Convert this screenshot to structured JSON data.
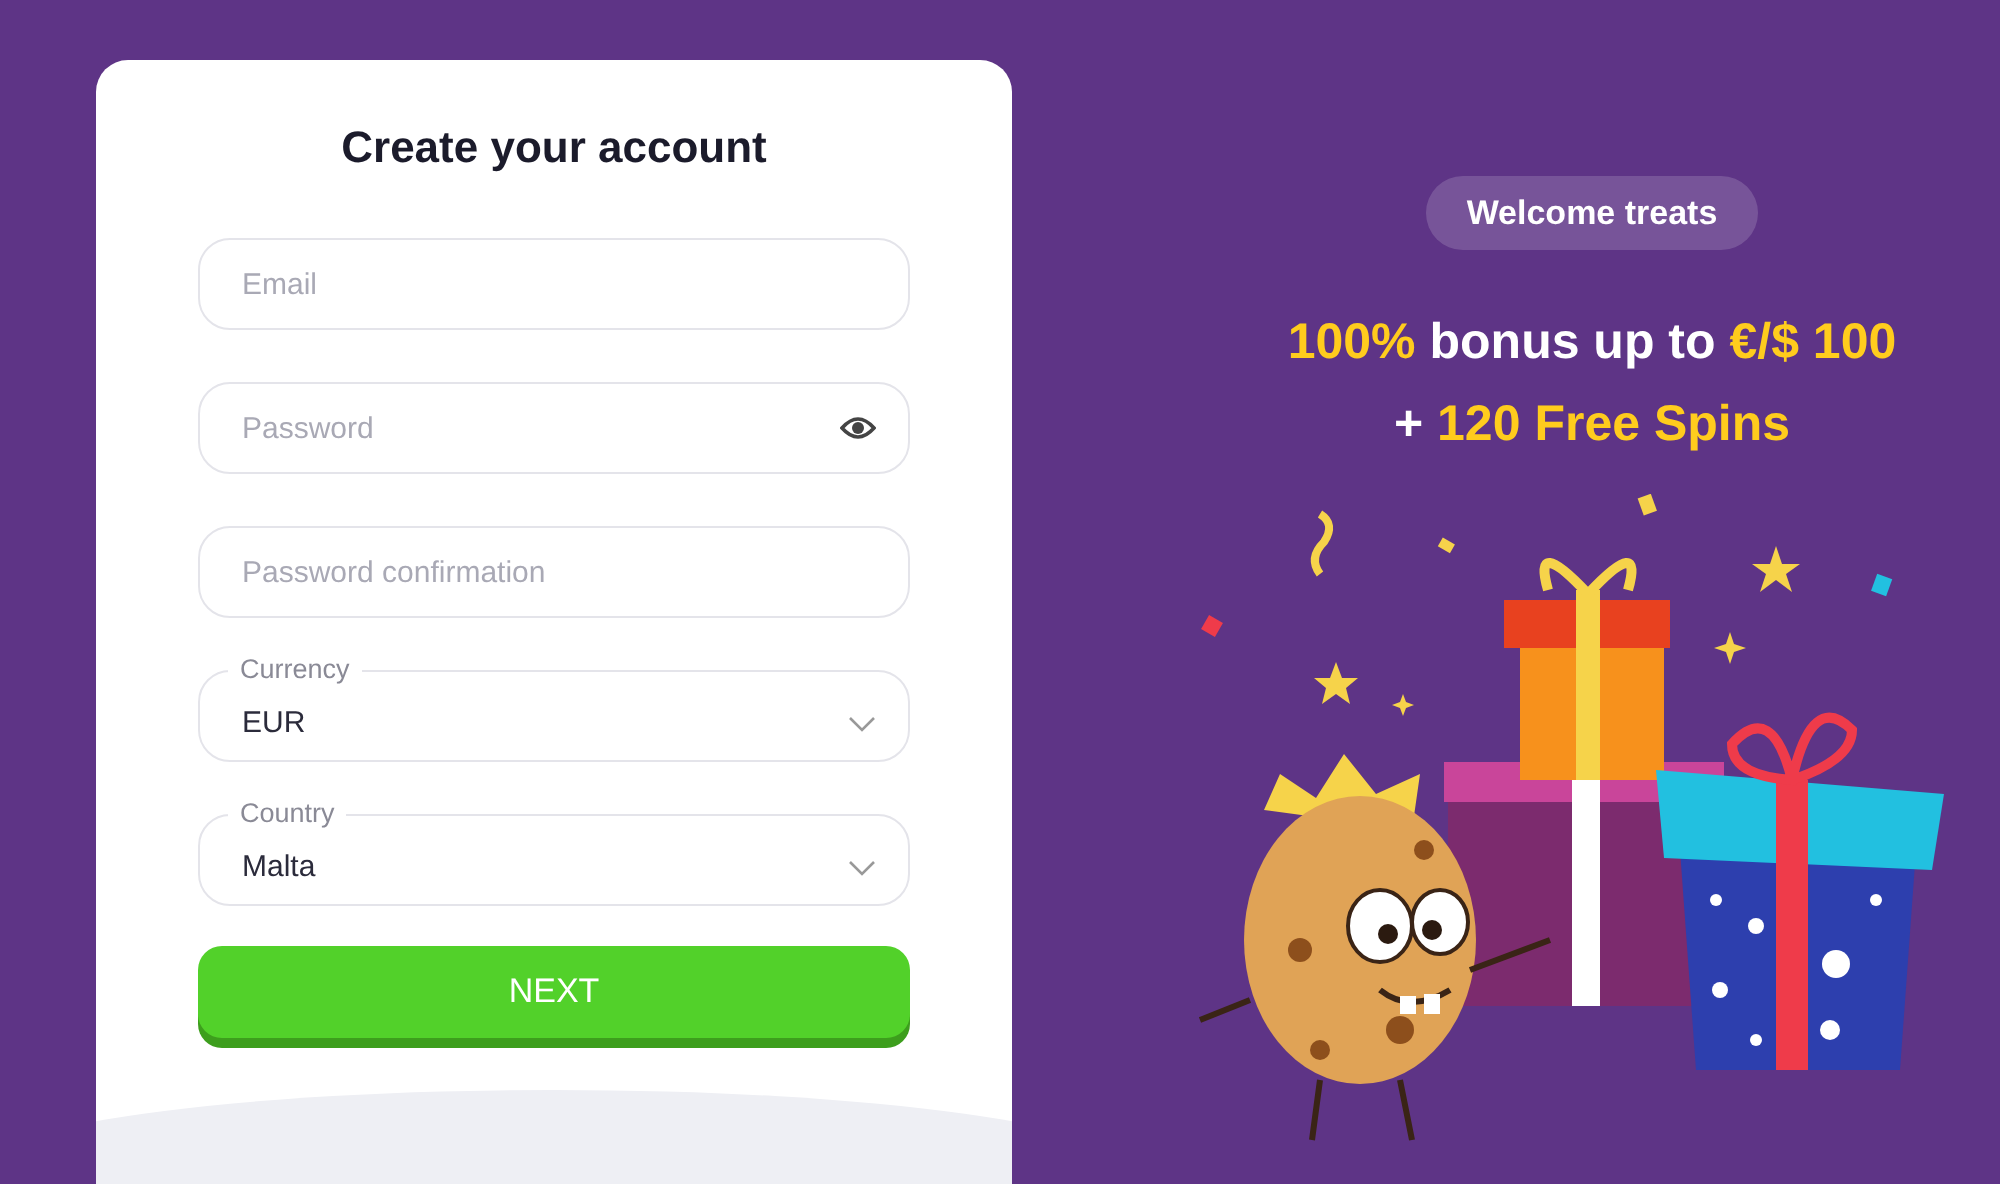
{
  "form": {
    "title": "Create your account",
    "fields": [
      {
        "kind": "text",
        "placeholder": "Email"
      },
      {
        "kind": "password",
        "placeholder": "Password"
      },
      {
        "kind": "text",
        "placeholder": "Password confirmation"
      },
      {
        "kind": "select",
        "label": "Currency",
        "value": "EUR"
      },
      {
        "kind": "select",
        "label": "Country",
        "value": "Malta"
      }
    ],
    "submit": "NEXT"
  },
  "promo": {
    "badge": "Welcome treats",
    "lines": [
      [
        {
          "text": "100%",
          "highlight": true
        },
        {
          "text": "bonus up to",
          "highlight": false
        },
        {
          "text": "€/$ 100",
          "highlight": true
        }
      ],
      [
        {
          "text": "+",
          "highlight": false
        },
        {
          "text": "120 Free Spins",
          "highlight": true
        }
      ]
    ]
  }
}
